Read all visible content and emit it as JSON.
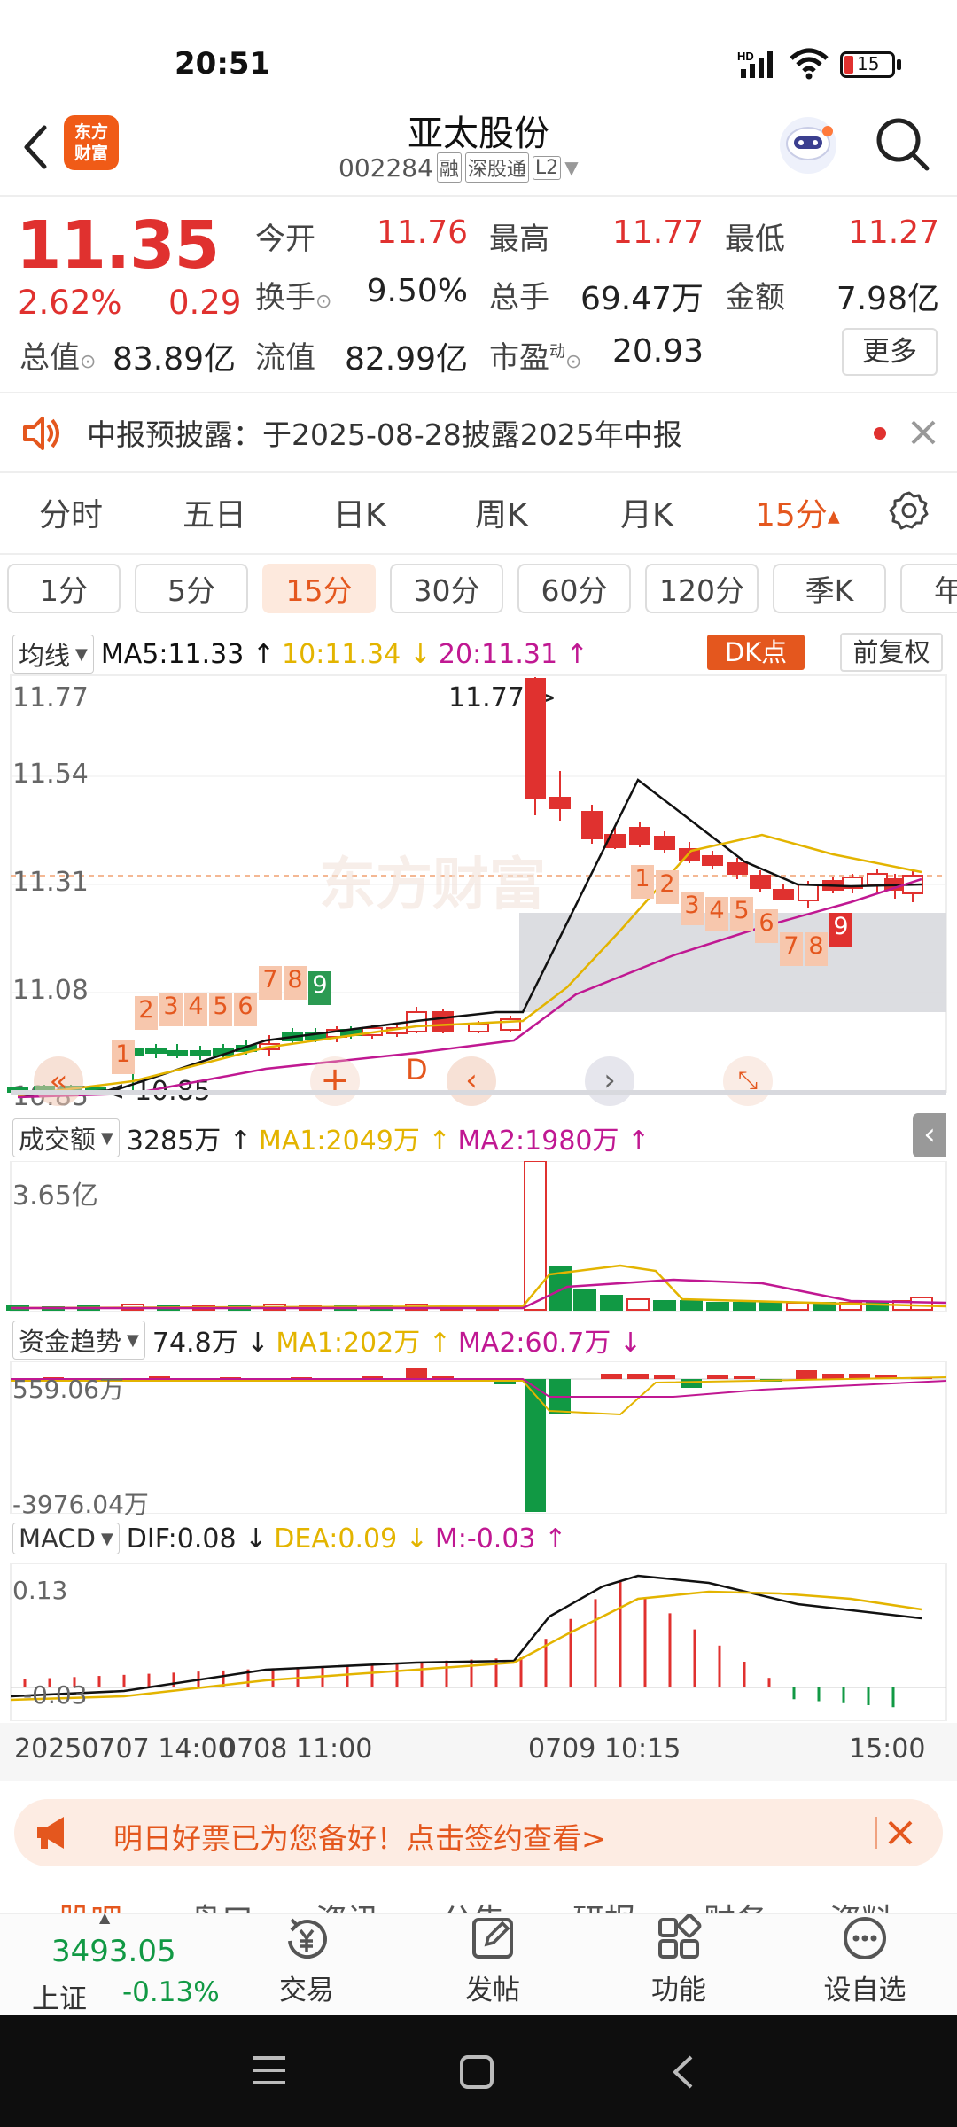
{
  "status_bar": {
    "time": "20:51",
    "battery": "15"
  },
  "header": {
    "title": "亚太股份",
    "code": "002284",
    "tags": [
      "融",
      "深股通",
      "L2"
    ],
    "logo_text": "东方\n财富"
  },
  "quote": {
    "price": "11.35",
    "change_pct": "2.62%",
    "change": "0.29",
    "open_label": "今开",
    "open": "11.76",
    "high_label": "最高",
    "high": "11.77",
    "low_label": "最低",
    "low": "11.27",
    "turnover_label": "换手",
    "turnover": "9.50%",
    "volume_label": "总手",
    "volume": "69.47万",
    "amount_label": "金额",
    "amount": "7.98亿",
    "mktcap_label": "总值",
    "mktcap": "83.89亿",
    "float_label": "流值",
    "float": "82.99亿",
    "pe_label": "市盈",
    "pe_sup": "动",
    "pe": "20.93",
    "more_label": "更多"
  },
  "notice": {
    "text": "中报预披露：于2025-08-28披露2025年中报"
  },
  "main_tabs": [
    "分时",
    "五日",
    "日K",
    "周K",
    "月K",
    "15分"
  ],
  "period_chips": [
    "1分",
    "5分",
    "15分",
    "30分",
    "60分",
    "120分",
    "季K",
    "年"
  ],
  "ma_legend": {
    "selector": "均线",
    "ma5": "MA5:11.33",
    "ma10": "10:11.34",
    "ma20": "20:11.31",
    "dk": "DK点",
    "adjust": "前复权"
  },
  "kline": {
    "y_labels": [
      "11.77",
      "11.54",
      "11.31",
      "11.08",
      "10.85"
    ],
    "high_marker": "11.77->",
    "low_marker": "<-10.85",
    "watermark": "东方财富",
    "d_marker": "D",
    "seq_labels_left": [
      "1",
      "2",
      "3",
      "4",
      "5",
      "6",
      "7",
      "8",
      "9"
    ],
    "seq_labels_right": [
      "1",
      "2",
      "3",
      "4",
      "5",
      "6",
      "7",
      "8",
      "9"
    ]
  },
  "volume_panel": {
    "selector": "成交额",
    "value": "3285万",
    "ma1": "MA1:2049万",
    "ma2": "MA2:1980万",
    "max_label": "3.65亿"
  },
  "fund_panel": {
    "selector": "资金趋势",
    "value": "74.8万",
    "ma1": "MA1:202万",
    "ma2": "MA2:60.7万",
    "top_label": "559.06万",
    "bottom_label": "-3976.04万"
  },
  "macd_panel": {
    "selector": "MACD",
    "dif": "DIF:0.08",
    "dea": "DEA:0.09",
    "m": "M:-0.03",
    "top_label": "0.13",
    "bottom_label": "-0.03"
  },
  "time_axis": [
    "20250707 14:00",
    "0708 11:00",
    "0709 10:15",
    "15:00"
  ],
  "banner": {
    "text": "明日好票已为您备好！点击签约查看>"
  },
  "hidden_tabs": [
    "股吧",
    "盘口",
    "资讯",
    "公告",
    "研报",
    "财务",
    "资料"
  ],
  "bottom_nav": {
    "index_value": "3493.05",
    "index_name": "上证",
    "index_change": "-0.13%",
    "items": [
      "交易",
      "发帖",
      "功能",
      "设自选"
    ]
  },
  "colors": {
    "up": "#e0312f",
    "down": "#119944",
    "accent": "#e4571e",
    "ma5": "#111111",
    "ma10": "#e3b400",
    "ma20": "#c01892"
  }
}
